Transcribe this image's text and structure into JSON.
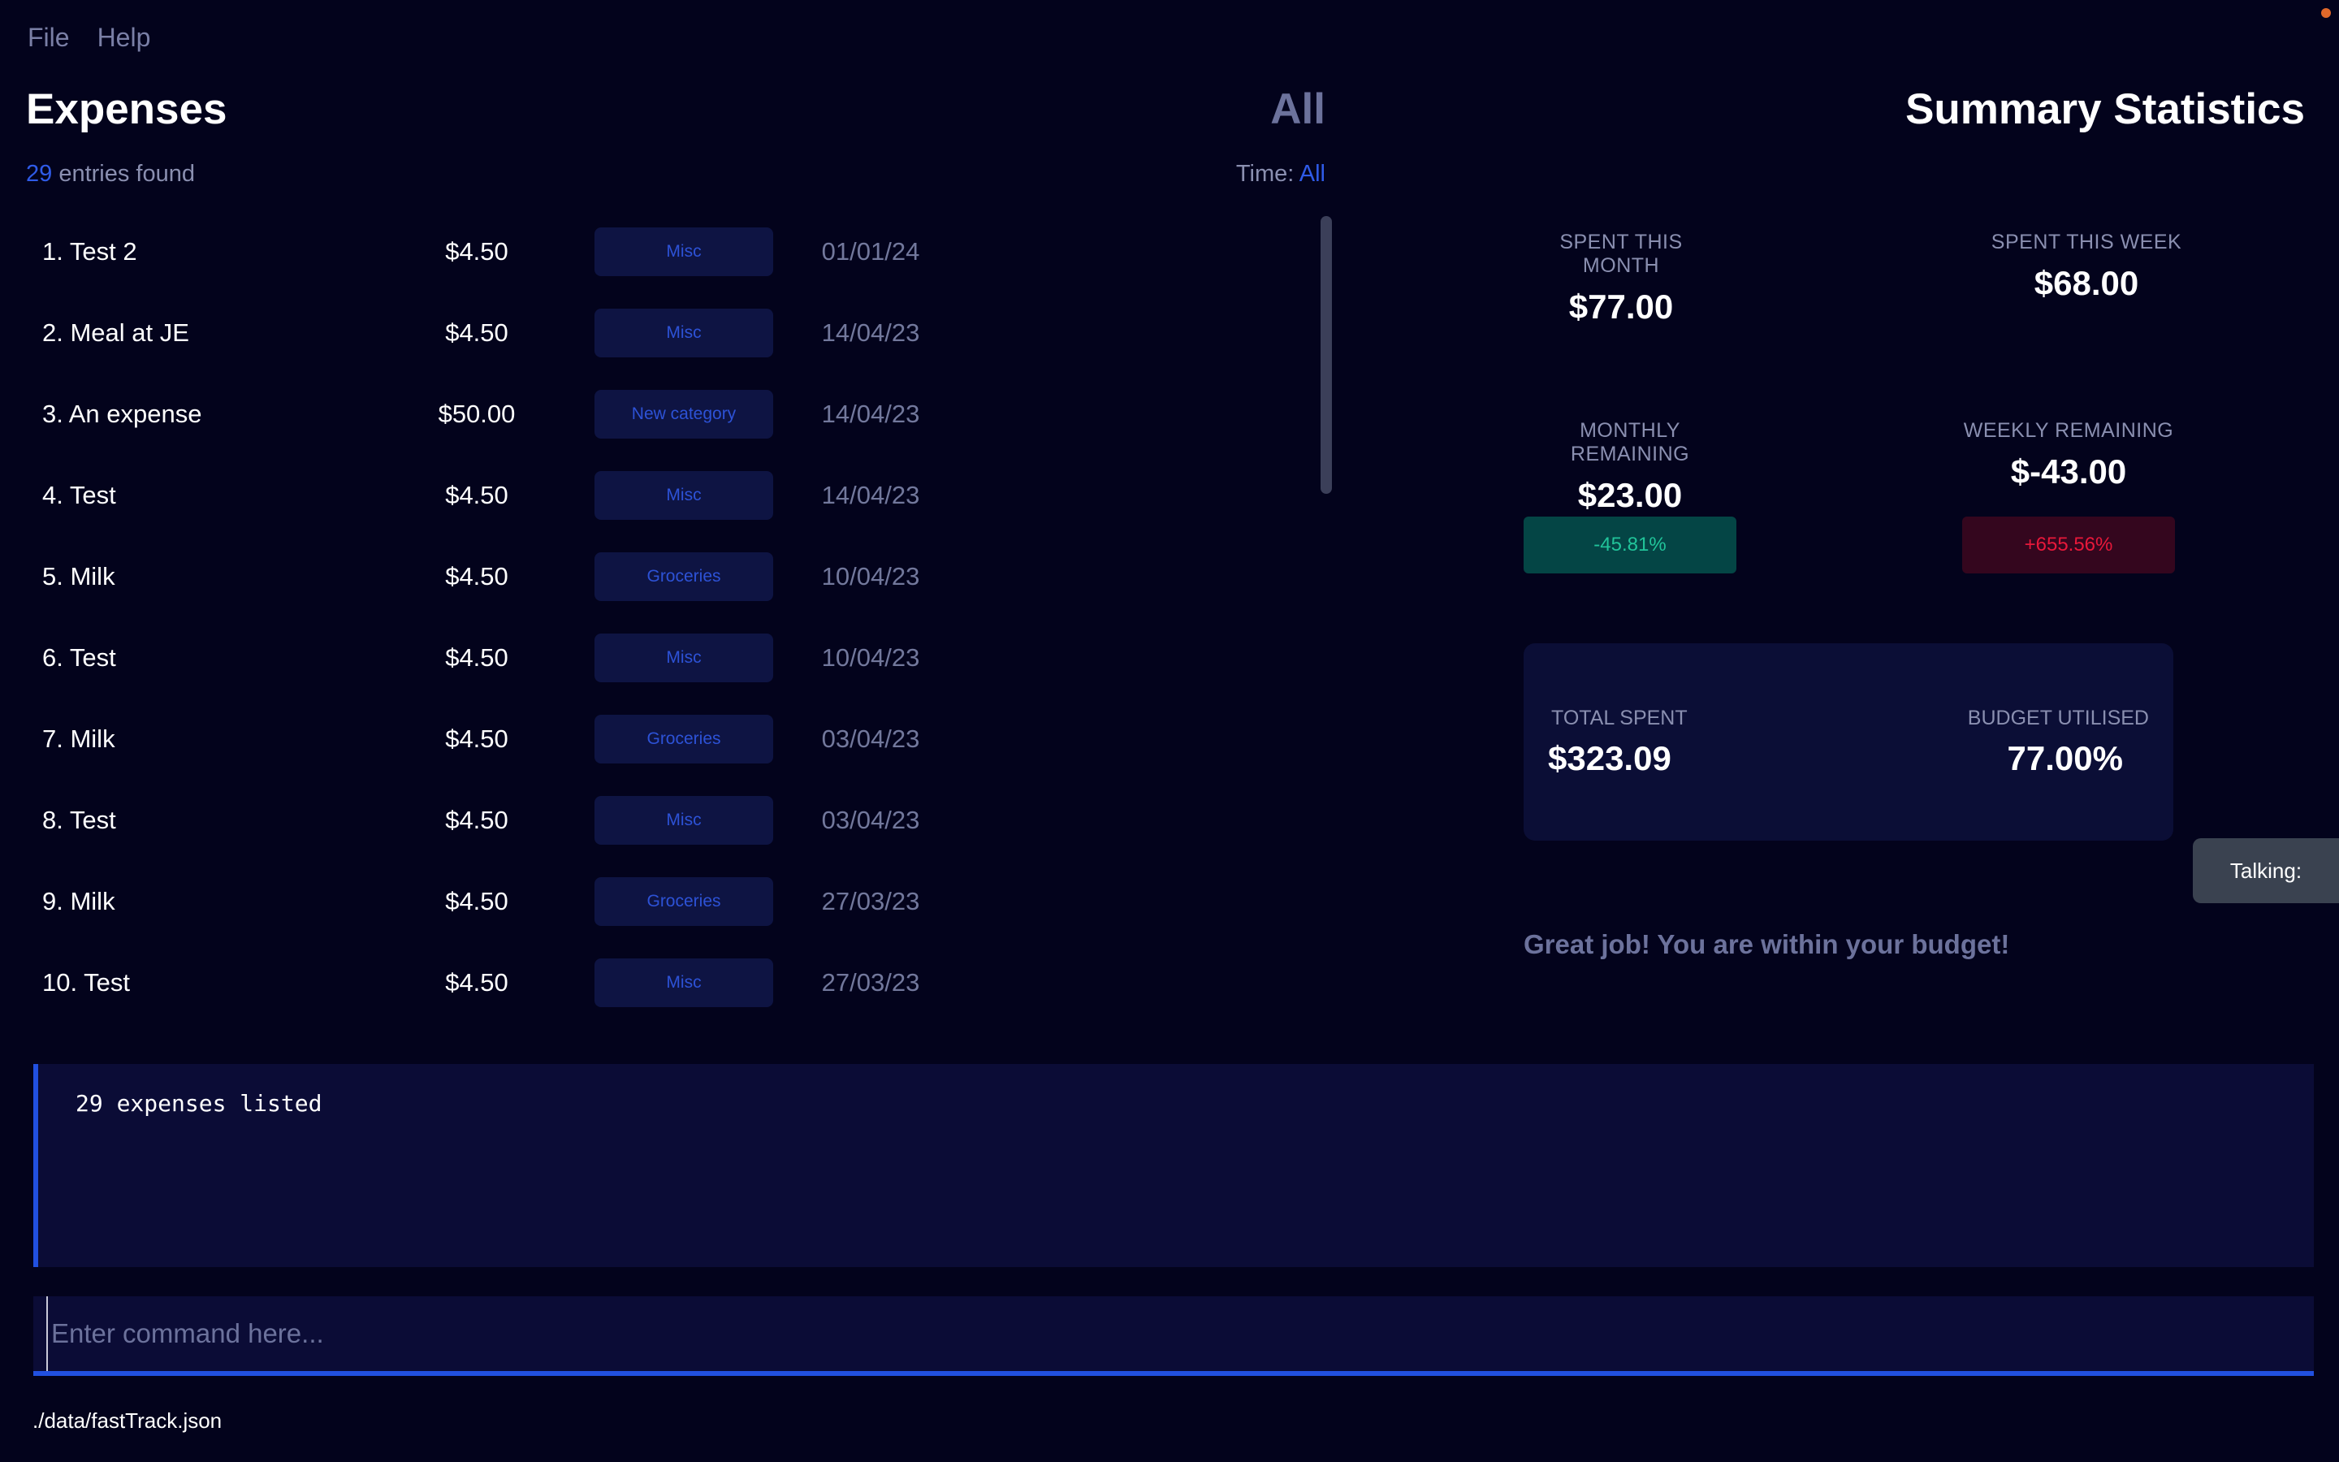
{
  "menu": {
    "items": [
      "File",
      "Help"
    ]
  },
  "expenses": {
    "title": "Expenses",
    "filter_label": "All",
    "entries_count": "29",
    "entries_suffix": "entries found",
    "time_label": "Time:",
    "time_value": "All",
    "rows": [
      {
        "name": "1.   Test 2",
        "amount": "$4.50",
        "category": "Misc",
        "date": "01/01/24"
      },
      {
        "name": "2.   Meal at JE",
        "amount": "$4.50",
        "category": "Misc",
        "date": "14/04/23"
      },
      {
        "name": "3.   An expense",
        "amount": "$50.00",
        "category": "New category",
        "date": "14/04/23"
      },
      {
        "name": "4.   Test",
        "amount": "$4.50",
        "category": "Misc",
        "date": "14/04/23"
      },
      {
        "name": "5.   Milk",
        "amount": "$4.50",
        "category": "Groceries",
        "date": "10/04/23"
      },
      {
        "name": "6.   Test",
        "amount": "$4.50",
        "category": "Misc",
        "date": "10/04/23"
      },
      {
        "name": "7.   Milk",
        "amount": "$4.50",
        "category": "Groceries",
        "date": "03/04/23"
      },
      {
        "name": "8.   Test",
        "amount": "$4.50",
        "category": "Misc",
        "date": "03/04/23"
      },
      {
        "name": "9.   Milk",
        "amount": "$4.50",
        "category": "Groceries",
        "date": "27/03/23"
      },
      {
        "name": "10.   Test",
        "amount": "$4.50",
        "category": "Misc",
        "date": "27/03/23"
      }
    ]
  },
  "summary": {
    "title": "Summary Statistics",
    "spent_month_label": "SPENT THIS MONTH",
    "spent_month_value": "$77.00",
    "spent_week_label": "SPENT THIS WEEK",
    "spent_week_value": "$68.00",
    "monthly_remaining_label": "MONTHLY REMAINING",
    "monthly_remaining_value": "$23.00",
    "monthly_pct": "-45.81%",
    "weekly_remaining_label": "WEEKLY REMAINING",
    "weekly_remaining_value": "$-43.00",
    "weekly_pct": "+655.56%",
    "total_spent_label": "TOTAL SPENT",
    "total_spent_value": "$323.09",
    "budget_utilised_label": "BUDGET UTILISED",
    "budget_utilised_value": "77.00%",
    "message": "Great job! You are within your budget!"
  },
  "talking": "Talking:",
  "result": {
    "text": "29 expenses listed"
  },
  "command": {
    "placeholder": "Enter command here..."
  },
  "status": {
    "file_path": "./data/fastTrack.json"
  },
  "colors": {
    "background": "#03031c",
    "accent": "#2150e0",
    "good": "#21c49a",
    "bad": "#e8183a"
  }
}
